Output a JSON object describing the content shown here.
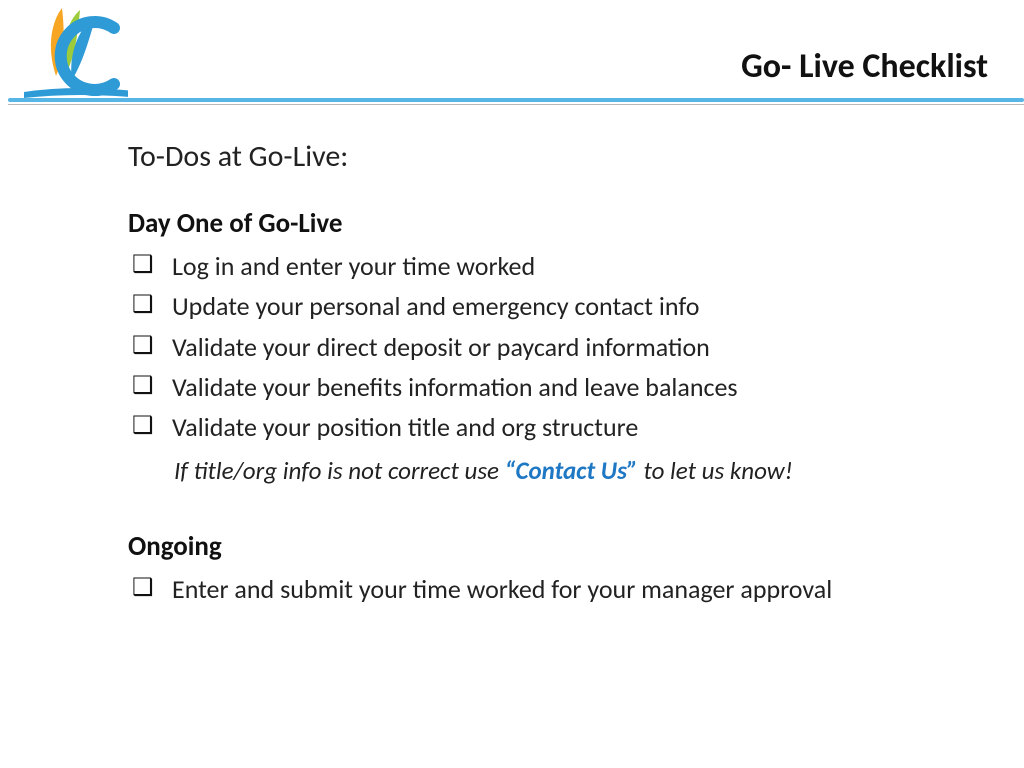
{
  "header": {
    "title": "Go- Live Checklist"
  },
  "content": {
    "subtitle": "To-Dos at Go-Live:",
    "section1": {
      "heading": "Day One of Go-Live",
      "items": [
        "Log in and enter your time worked",
        "Update your personal and emergency contact info",
        "Validate your direct deposit or paycard information",
        "Validate your benefits information and leave balances",
        "Validate your position title and org structure"
      ],
      "note_pre": "If title/org info is not correct use ",
      "note_highlight": "“Contact Us”",
      "note_post": " to let us know!"
    },
    "section2": {
      "heading": "Ongoing",
      "items": [
        "Enter and submit your time worked for your manager approval"
      ]
    }
  }
}
